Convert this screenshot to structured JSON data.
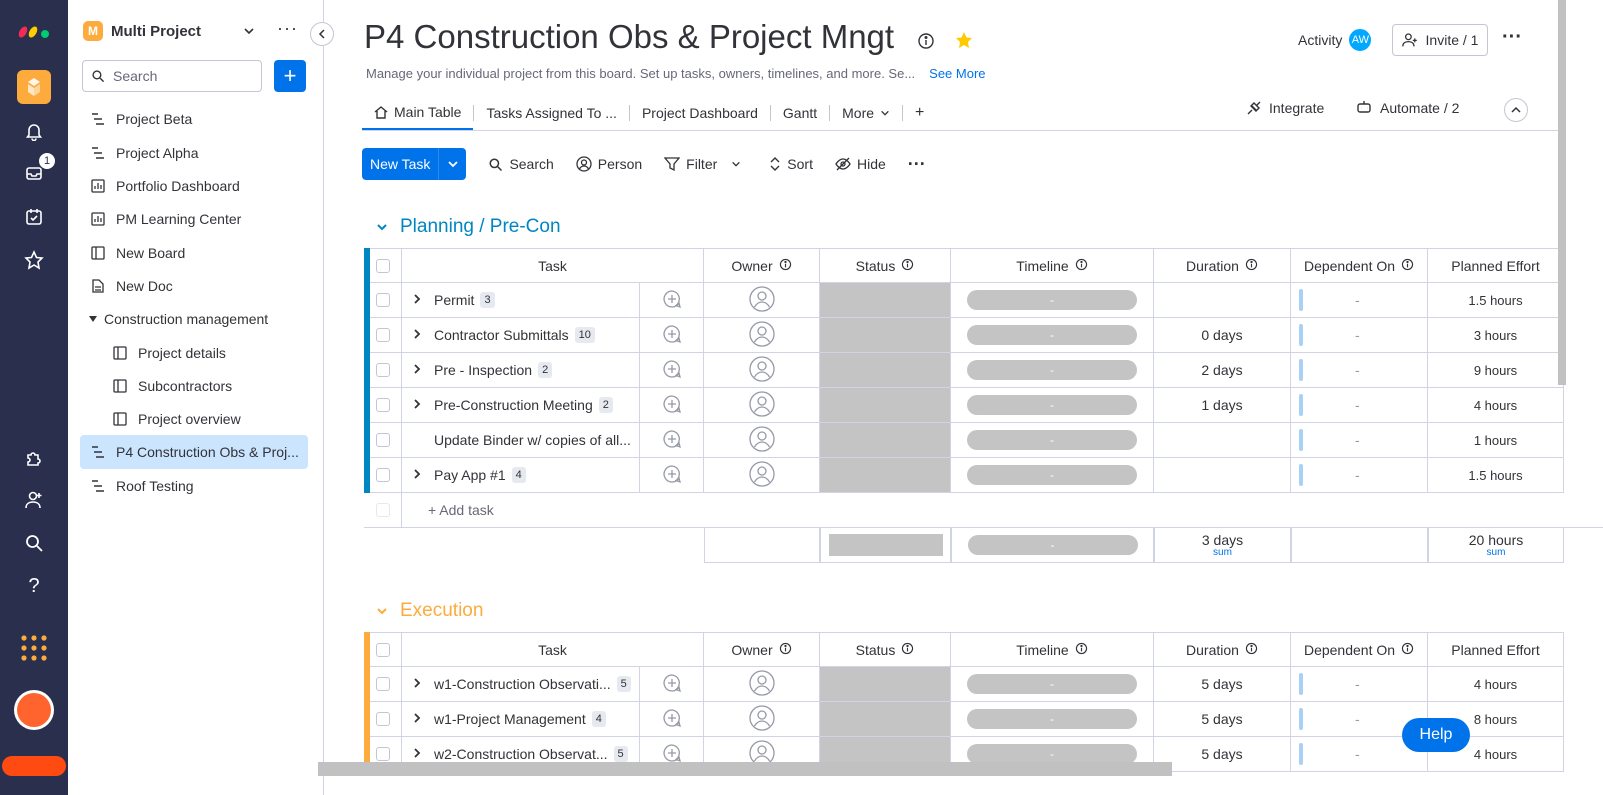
{
  "colors": {
    "rail": "#292f4c",
    "accent": "#0073ea",
    "planning": "#0086c0",
    "execution": "#fdab3d",
    "status_empty": "#c4c4c4"
  },
  "rail": {
    "inbox_badge": "1"
  },
  "sidebar": {
    "workspace_badge": "M",
    "workspace_name": "Multi Project",
    "search_placeholder": "Search",
    "items": [
      {
        "label": "Project Beta",
        "icon": "board-icon"
      },
      {
        "label": "Project Alpha",
        "icon": "board-icon"
      },
      {
        "label": "Portfolio Dashboard",
        "icon": "dashboard-icon"
      },
      {
        "label": "PM Learning Center",
        "icon": "dashboard-icon"
      },
      {
        "label": "New Board",
        "icon": "board-outline-icon"
      },
      {
        "label": "New Doc",
        "icon": "doc-icon"
      },
      {
        "label": "Construction management",
        "icon": "folder-caret-icon"
      },
      {
        "label": "Project details",
        "icon": "board-outline-icon"
      },
      {
        "label": "Subcontractors",
        "icon": "board-outline-icon"
      },
      {
        "label": "Project overview",
        "icon": "board-outline-icon"
      },
      {
        "label": "P4 Construction Obs & Proj...",
        "icon": "board-icon"
      },
      {
        "label": "Roof Testing",
        "icon": "board-icon"
      }
    ]
  },
  "header": {
    "title": "P4 Construction Obs & Project Mngt",
    "subtitle": "Manage your individual project from this board. Set up tasks, owners, timelines, and more. Se...",
    "see_more": "See More",
    "activity": "Activity",
    "avatar": "AW",
    "invite": "Invite / 1"
  },
  "tabs": [
    "Main Table",
    "Tasks Assigned To ...",
    "Project Dashboard",
    "Gantt",
    "More"
  ],
  "tabs_right": {
    "integrate": "Integrate",
    "automate": "Automate / 2"
  },
  "toolbar": {
    "new_task": "New Task",
    "search": "Search",
    "person": "Person",
    "filter": "Filter",
    "sort": "Sort",
    "hide": "Hide"
  },
  "columns": [
    "Task",
    "Owner",
    "Status",
    "Timeline",
    "Duration",
    "Dependent On",
    "Planned Effort"
  ],
  "timeline_placeholder": "-",
  "dependent_placeholder": "-",
  "groups": [
    {
      "name": "Planning / Pre-Con",
      "rows": [
        {
          "task": "Permit",
          "count": "3",
          "duration": "",
          "effort": "1.5 hours",
          "expand": true
        },
        {
          "task": "Contractor Submittals",
          "count": "10",
          "duration": "0 days",
          "effort": "3 hours",
          "expand": true
        },
        {
          "task": "Pre - Inspection",
          "count": "2",
          "duration": "2 days",
          "effort": "9 hours",
          "expand": true
        },
        {
          "task": "Pre-Construction Meeting",
          "count": "2",
          "duration": "1 days",
          "effort": "4 hours",
          "expand": true
        },
        {
          "task": "Update Binder w/ copies of all...",
          "count": "",
          "duration": "",
          "effort": "1 hours",
          "expand": false
        },
        {
          "task": "Pay App #1",
          "count": "4",
          "duration": "",
          "effort": "1.5 hours",
          "expand": true
        }
      ],
      "add_task": "+ Add task",
      "footer": {
        "timeline": "-",
        "duration": "3 days",
        "duration_label": "sum",
        "effort": "20 hours",
        "effort_label": "sum"
      }
    },
    {
      "name": "Execution",
      "rows": [
        {
          "task": "w1-Construction Observati...",
          "count": "5",
          "duration": "5 days",
          "effort": "4 hours",
          "expand": true
        },
        {
          "task": "w1-Project Management",
          "count": "4",
          "duration": "5 days",
          "effort": "8 hours",
          "expand": true
        },
        {
          "task": "w2-Construction Observat...",
          "count": "5",
          "duration": "5 days",
          "effort": "4 hours",
          "expand": true
        }
      ]
    }
  ],
  "help": "Help"
}
